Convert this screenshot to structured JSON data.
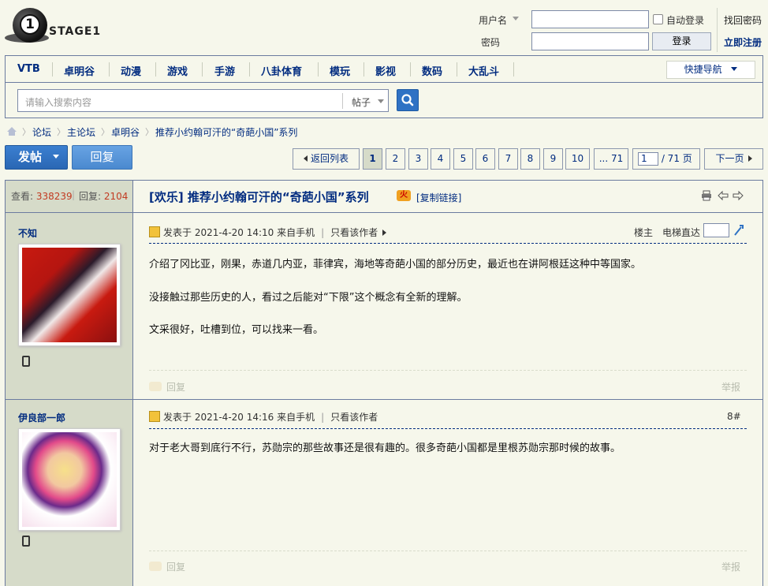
{
  "header": {
    "logo_text": "STAGE1",
    "username_label": "用户名",
    "password_label": "密码",
    "auto_login": "自动登录",
    "login_button": "登录",
    "forgot_password": "找回密码",
    "register": "立即注册"
  },
  "nav": {
    "items": [
      "VTB",
      "卓明谷",
      "动漫",
      "游戏",
      "手游",
      "八卦体育",
      "模玩",
      "影视",
      "数码",
      "大乱斗"
    ],
    "quick_nav": "快捷导航"
  },
  "search": {
    "placeholder": "请输入搜索内容",
    "type": "帖子"
  },
  "breadcrumb": [
    "论坛",
    "主论坛",
    "卓明谷",
    "推荐小约翰可汗的“奇葩小国”系列"
  ],
  "actions": {
    "post": "发帖",
    "reply": "回复"
  },
  "pager": {
    "back": "返回列表",
    "pages": [
      "1",
      "2",
      "3",
      "4",
      "5",
      "6",
      "7",
      "8",
      "9",
      "10"
    ],
    "last": "... 71",
    "current_input": "1",
    "total": "/ 71 页",
    "next": "下一页"
  },
  "thread": {
    "views_label": "查看:",
    "views": "338239",
    "replies_label": "回复:",
    "replies": "2104",
    "title": "[欢乐] 推荐小约翰可汗的“奇葩小国”系列",
    "hot_badge": "火",
    "copy_link": "[复制链接]"
  },
  "posts": [
    {
      "author": "不知",
      "meta_time": "发表于 2021-4-20 14:10 来自手机",
      "only_author": "只看该作者",
      "floor_label": "楼主",
      "jump_label": "电梯直达",
      "lines": [
        "介绍了冈比亚，刚果，赤道几内亚，菲律宾，海地等奇葩小国的部分历史，最近也在讲阿根廷这种中等国家。",
        "没接触过那些历史的人，看过之后能对“下限”这个概念有全新的理解。",
        "文采很好，吐槽到位，可以找来一看。"
      ],
      "reply": "回复",
      "report": "举报"
    },
    {
      "author": "伊良部一郎",
      "meta_time": "发表于 2021-4-20 14:16 来自手机",
      "only_author": "只看该作者",
      "floor_label": "8#",
      "lines": [
        "对于老大哥到底行不行，苏勋宗的那些故事还是很有趣的。很多奇葩小国都是里根苏勋宗那时候的故事。"
      ],
      "reply": "回复",
      "report": "举报"
    }
  ],
  "colors": {
    "background": "#f6f7eb",
    "sidebar": "#d6dbc9",
    "accent": "#022c80",
    "button_blue": "#2f72c4",
    "count_red": "#c23b22"
  }
}
